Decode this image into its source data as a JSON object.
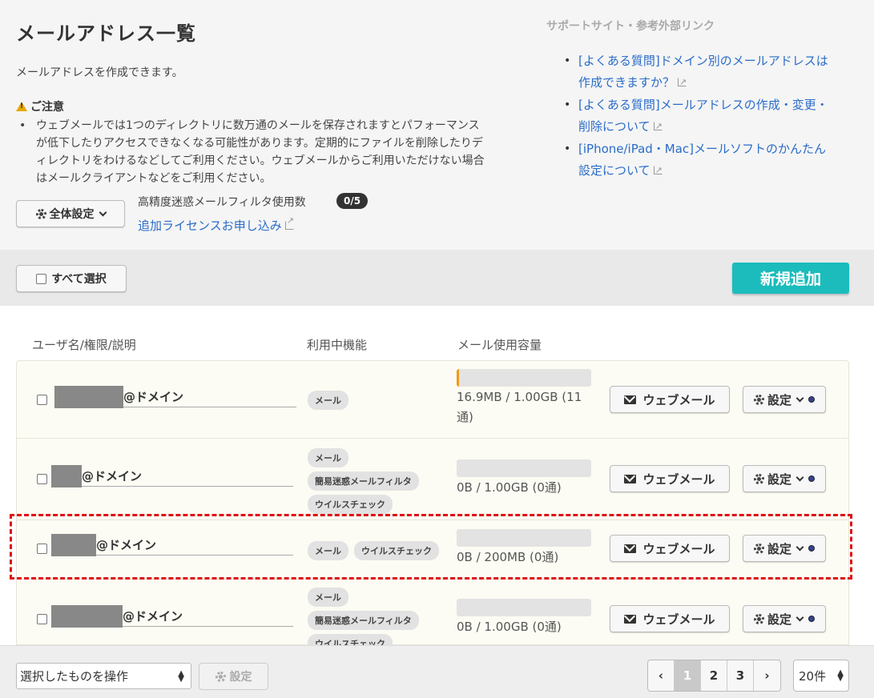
{
  "header": {
    "title": "メールアドレス一覧",
    "intro": "メールアドレスを作成できます。",
    "notice_title": "ご注意",
    "notice_lines": [
      "ウェブメールでは1つのディレクトリに数万通のメールを保存されますとパフォーマンス",
      "が低下したりアクセスできなくなる可能性があります。定期的にファイルを削除したりデ",
      "ィレクトリをわけるなどしてご利用ください。ウェブメールからご利用いただけない場合",
      "はメールクライアントなどをご利用ください。"
    ]
  },
  "settings": {
    "global_button": "全体設定",
    "filter_label": "高精度迷惑メールフィルタ使用数",
    "filter_count": "0/5",
    "license_link": "追加ライセンスお申し込み"
  },
  "sidebar": {
    "title": "サポートサイト・参考外部リンク",
    "links": [
      {
        "line1": "[よくある質問]ドメイン別のメールアドレスは",
        "line2": "作成できますか？"
      },
      {
        "line1": "[よくある質問]メールアドレスの作成・変更・",
        "line2": "削除について"
      },
      {
        "line1": "[iPhone/iPad・Mac]メールソフトのかんたん",
        "line2": "設定について"
      }
    ]
  },
  "toolbar": {
    "select_all": "すべて選択",
    "add_new": "新規追加"
  },
  "table": {
    "columns": [
      "ユーザ名/権限/説明",
      "利用中機能",
      "メール使用容量"
    ],
    "webmail_label": "ウェブメール",
    "settings_label": "設定",
    "rows": [
      {
        "domain": "@ドメイン",
        "features": [
          "メール"
        ],
        "usage_line1": "16.9MB / 1.00GB (11",
        "usage_line2": "通)",
        "usage_fraction": 0.017
      },
      {
        "domain": "@ドメイン",
        "features": [
          "メール",
          "簡易迷惑メールフィルタ",
          "ウイルスチェック"
        ],
        "usage_line1": "0B / 1.00GB (0通)",
        "usage_line2": "",
        "usage_fraction": 0
      },
      {
        "domain": "@ドメイン",
        "features": [
          "メール",
          "ウイルスチェック"
        ],
        "usage_line1": "0B / 200MB (0通)",
        "usage_line2": "",
        "usage_fraction": 0
      },
      {
        "domain": "@ドメイン",
        "features": [
          "メール",
          "簡易迷惑メールフィルタ",
          "ウイルスチェック"
        ],
        "usage_line1": "0B / 1.00GB (0通)",
        "usage_line2": "",
        "usage_fraction": 0
      }
    ]
  },
  "footer": {
    "bulk_action": "選択したものを操作",
    "settings_button": "設定",
    "pages": [
      "‹",
      "1",
      "2",
      "3",
      "›"
    ],
    "current_page": "1",
    "per_page": "20件"
  },
  "colors": {
    "accent": "#1cbcbc",
    "link": "#2a6cc9",
    "usage_bar": "#f29a1b",
    "highlight": "#dd1111"
  }
}
